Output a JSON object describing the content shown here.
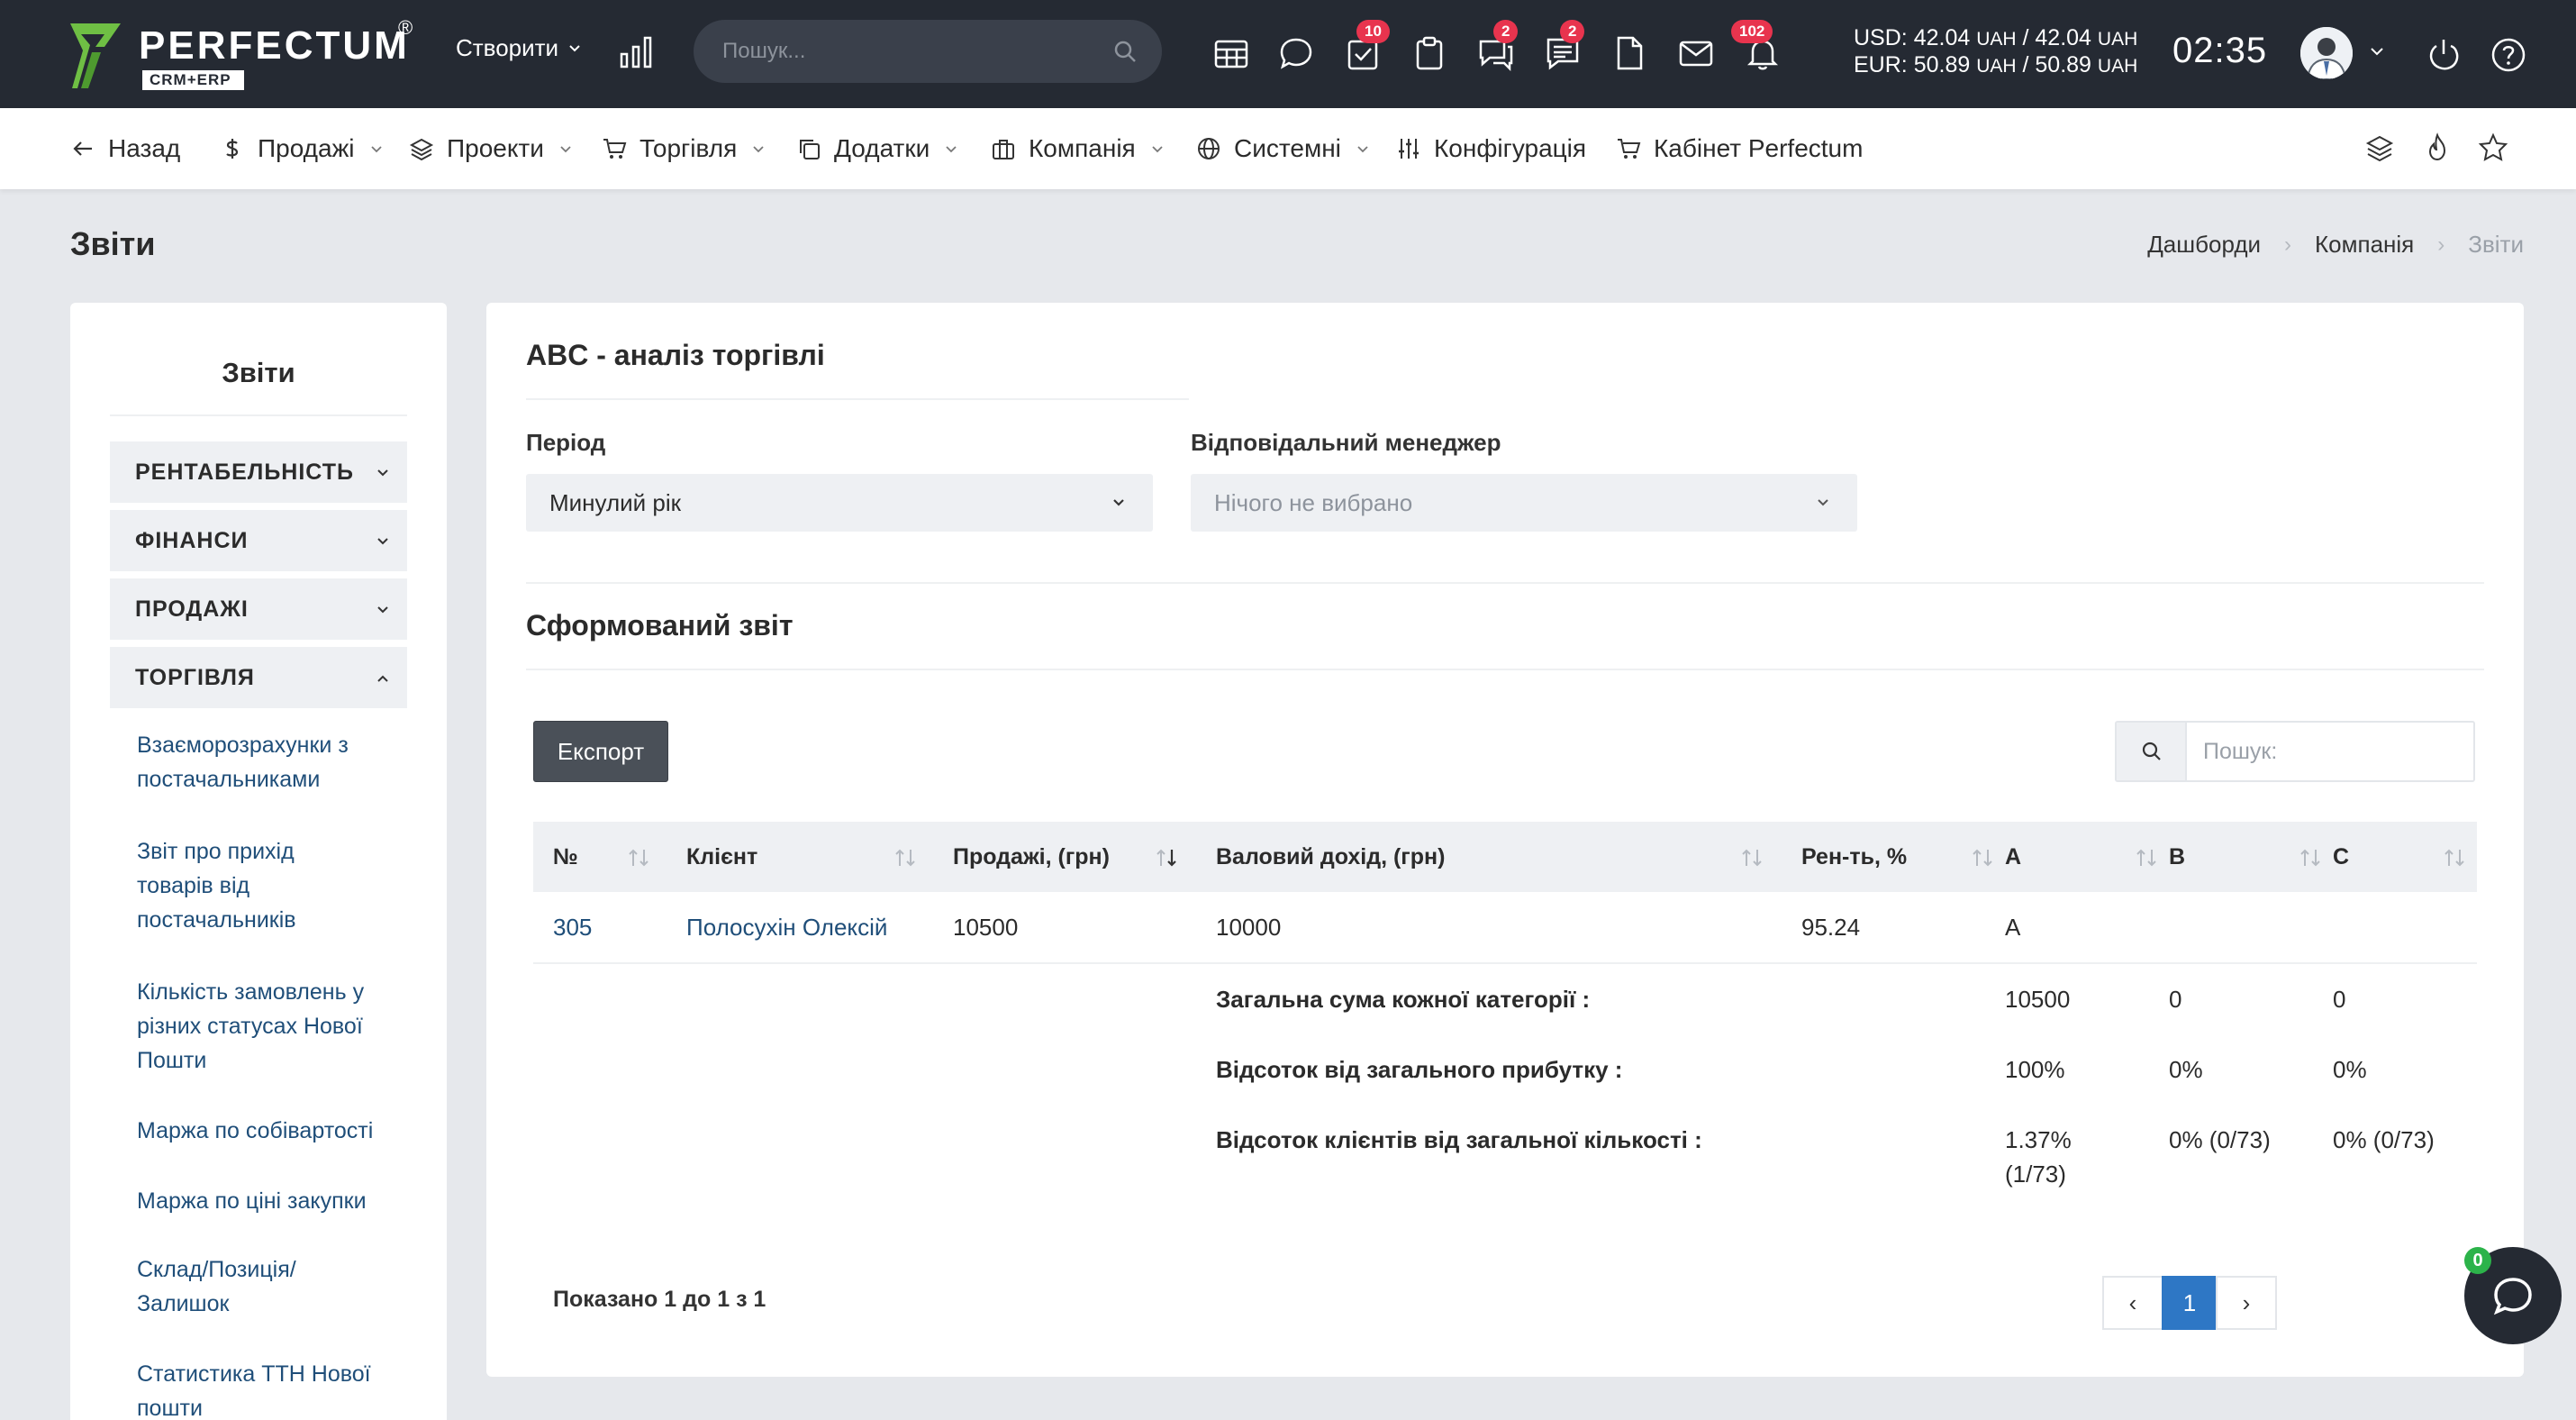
{
  "app": {
    "logo_text": "PERFECTUM",
    "logo_sub": "CRM+ERP",
    "logo_reg": "®",
    "brand_color": "#6fbf44"
  },
  "topbar": {
    "create_label": "Створити",
    "search_placeholder": "Пошук...",
    "badges": {
      "tasks": "10",
      "chat": "2",
      "messages": "2",
      "notifications": "102"
    },
    "rates": {
      "usd_label": "USD:",
      "usd_values": "42.04",
      "usd_second": "42.04",
      "eur_label": "EUR:",
      "eur_values": "50.89",
      "eur_second": "50.89",
      "currency": "UAH"
    },
    "clock": "02:35"
  },
  "nav": {
    "back": "Назад",
    "items": [
      "Продажі",
      "Проекти",
      "Торгівля",
      "Додатки",
      "Компанія",
      "Системні",
      "Конфігурація",
      "Кабінет Perfectum"
    ]
  },
  "page": {
    "title": "Звіти",
    "breadcrumb": [
      "Дашборди",
      "Компанія",
      "Звіти"
    ]
  },
  "sidebar": {
    "title": "Звіти",
    "categories": [
      "РЕНТАБЕЛЬНІСТЬ",
      "ФІНАНСИ",
      "ПРОДАЖІ",
      "ТОРГІВЛЯ"
    ],
    "links": [
      [
        "Взаєморозрахунки з",
        "постачальниками"
      ],
      [
        "Звіт про прихід",
        "товарів від",
        "постачальників"
      ],
      [
        "Кількість замовлень у",
        "різних статусах Нової",
        "Пошти"
      ],
      [
        "Маржа по собівартості"
      ],
      [
        "Маржа по ціні закупки"
      ],
      [
        "Склад/Позиція/",
        "Залишок"
      ],
      [
        "Статистика ТТН Нової",
        "пошти"
      ]
    ]
  },
  "report": {
    "title": "ABC - аналіз торгівлі",
    "period_label": "Період",
    "period_value": "Минулий рік",
    "manager_label": "Відповідальний менеджер",
    "manager_placeholder": "Нічого не вибрано",
    "subtitle": "Сформований звіт",
    "export_label": "Експорт",
    "search_placeholder": "Пошук:",
    "columns": [
      "№",
      "Клієнт",
      "Продажі, (грн)",
      "Валовий дохід, (грн)",
      "Рен-ть, %",
      "A",
      "B",
      "C"
    ],
    "rows": [
      {
        "no": "305",
        "client": "Полосухін Олексій",
        "sales": "10500",
        "gross": "10000",
        "profitability": "95.24",
        "a": "A",
        "b": "",
        "c": ""
      }
    ],
    "summary": {
      "total_label": "Загальна сума кожної категорії :",
      "total": [
        "10500",
        "0",
        "0"
      ],
      "profit_pct_label": "Відсоток від загального прибутку :",
      "profit_pct": [
        "100%",
        "0%",
        "0%"
      ],
      "clients_pct_label": "Відсоток клієнтів від загальної кількості :",
      "clients_pct": [
        "1.37%",
        "(1/73)",
        "0% (0/73)",
        "0% (0/73)"
      ]
    },
    "showing": "Показано 1 до 1 з 1",
    "pagination": {
      "prev": "‹",
      "current": "1",
      "next": "›"
    }
  },
  "chat": {
    "badge": "0"
  }
}
